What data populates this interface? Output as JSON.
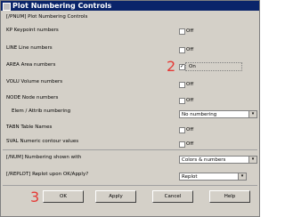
{
  "window": {
    "title": "Plot Numbering Controls"
  },
  "header": {
    "command": "[/PNUM] Plot Numbering Controls"
  },
  "rows": [
    {
      "label": "KP   Keypoint numbers",
      "value": "Off",
      "checked": false
    },
    {
      "label": "LINE  Line numbers",
      "value": "Off",
      "checked": false
    },
    {
      "label": "AREA  Area numbers",
      "value": "On",
      "checked": true
    },
    {
      "label": "VOLU  Volume numbers",
      "value": "Off",
      "checked": false
    },
    {
      "label": "NODE  Node numbers",
      "value": "Off",
      "checked": false
    },
    {
      "label": "TABN  Table Names",
      "value": "Off",
      "checked": false
    },
    {
      "label": "SVAL  Numeric contour values",
      "value": "Off",
      "checked": false
    }
  ],
  "elem_attrib": {
    "label": "Elem / Attrib numbering",
    "value": "No numbering"
  },
  "num_shown": {
    "label": "[/NUM]  Numbering shown with",
    "value": "Colors & numbers"
  },
  "replot": {
    "label": "[/REPLOT] Replot upon OK/Apply?",
    "value": "Replot"
  },
  "buttons": {
    "ok": "OK",
    "apply": "Apply",
    "cancel": "Cancel",
    "help": "Help"
  },
  "callouts": {
    "step2": "2",
    "step3": "3"
  }
}
